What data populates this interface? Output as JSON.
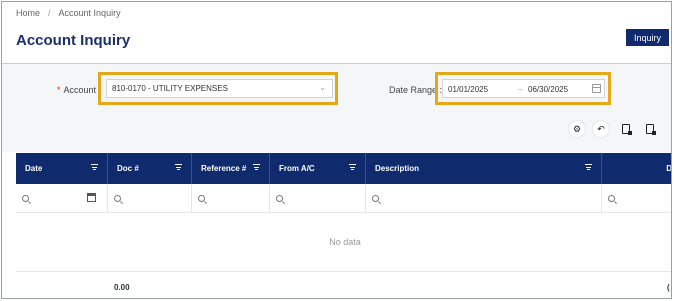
{
  "breadcrumb": {
    "home": "Home",
    "separator": "/",
    "current": "Account Inquiry"
  },
  "page": {
    "title": "Account Inquiry"
  },
  "toolbar": {
    "inquiry_label": "Inquiry"
  },
  "filters": {
    "account": {
      "required_mark": "*",
      "label": "Account",
      "value": "810-0170 - UTILITY EXPENSES",
      "chevron": "⌄"
    },
    "date_range": {
      "label": "Date Range :",
      "start": "01/01/2025",
      "arrow": "→",
      "end": "06/30/2025"
    }
  },
  "grid_tools": {
    "settings_icon": "gear-icon",
    "undo_icon": "undo-icon",
    "export_icon": "document-export-icon",
    "report_icon": "document-report-icon"
  },
  "grid": {
    "columns": [
      "Date",
      "Doc #",
      "Reference #",
      "From A/C",
      "Description",
      "D"
    ],
    "empty_text": "No data",
    "totals": [
      "0.00",
      "("
    ]
  },
  "colors": {
    "primary": "#0f2b6d",
    "highlight": "#e4a81a",
    "title": "#1b2f6b"
  }
}
